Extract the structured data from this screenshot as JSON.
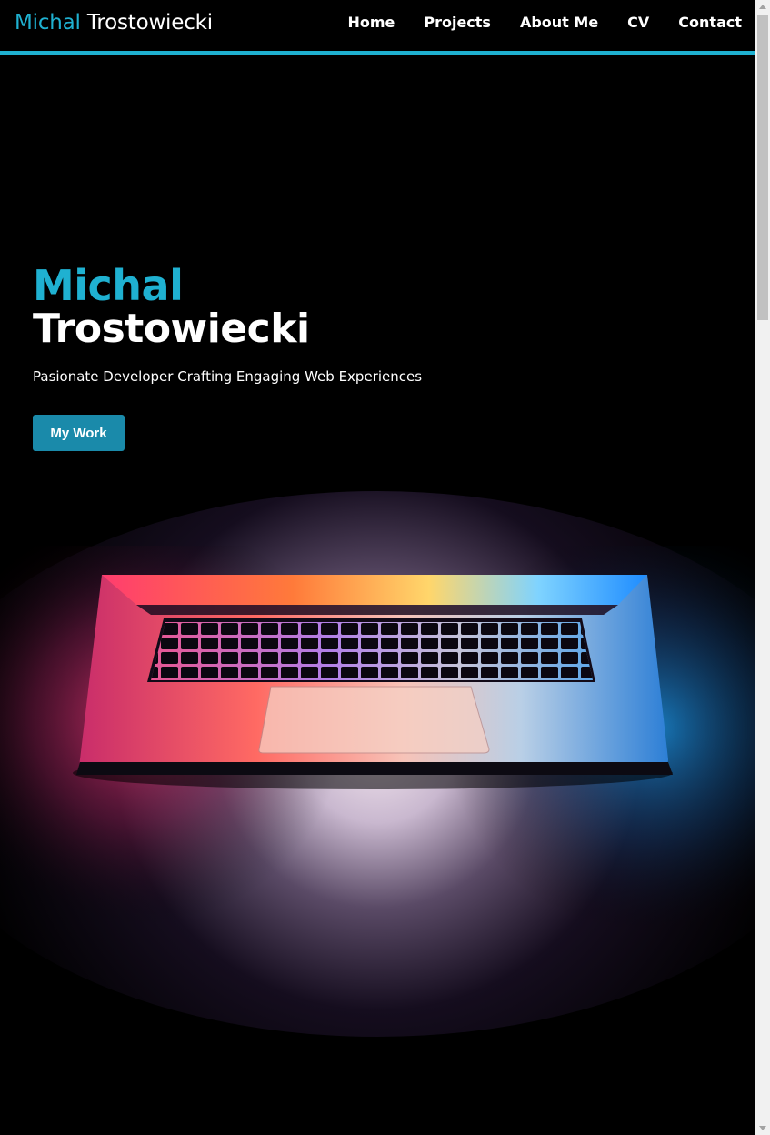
{
  "header": {
    "brand_first": "Michal",
    "brand_last": "Trostowiecki",
    "nav": [
      "Home",
      "Projects",
      "About Me",
      "CV",
      "Contact"
    ]
  },
  "hero": {
    "first_name": "Michal",
    "last_name": "Trostowiecki",
    "tagline": "Pasionate Developer Crafting Engaging Web Experiences",
    "cta_label": "My Work"
  },
  "colors": {
    "accent": "#1fb1d1",
    "button": "#1a8aaa",
    "background": "#000000"
  },
  "icons": {
    "hero_image": "laptop-glow-image"
  }
}
